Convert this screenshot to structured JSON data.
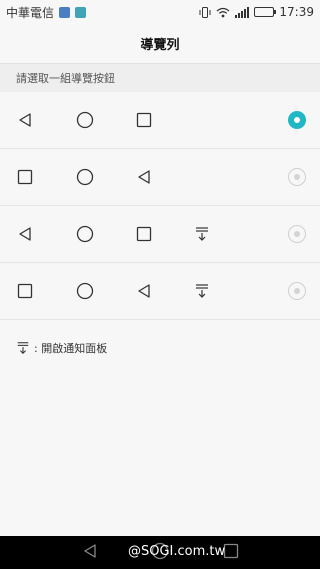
{
  "status": {
    "carrier": "中華電信",
    "time": "17:39"
  },
  "title": "導覽列",
  "section_header": "請選取一組導覽按鈕",
  "options": [
    {
      "buttons": [
        "back",
        "home",
        "recent"
      ],
      "selected": true
    },
    {
      "buttons": [
        "recent",
        "home",
        "back"
      ],
      "selected": false
    },
    {
      "buttons": [
        "back",
        "home",
        "recent",
        "notification"
      ],
      "selected": false
    },
    {
      "buttons": [
        "recent",
        "home",
        "back",
        "notification"
      ],
      "selected": false
    }
  ],
  "legend_text": ": 開啟通知面板",
  "navbar": {
    "icons": [
      "back-icon",
      "home-icon",
      "recent-apps-icon"
    ]
  },
  "watermark": "@SOGI.com.tw",
  "colors": {
    "accent": "#21b8c5",
    "background": "#f7f7f7",
    "section_bg": "#eeeeee",
    "navbar_bg": "#000000"
  }
}
